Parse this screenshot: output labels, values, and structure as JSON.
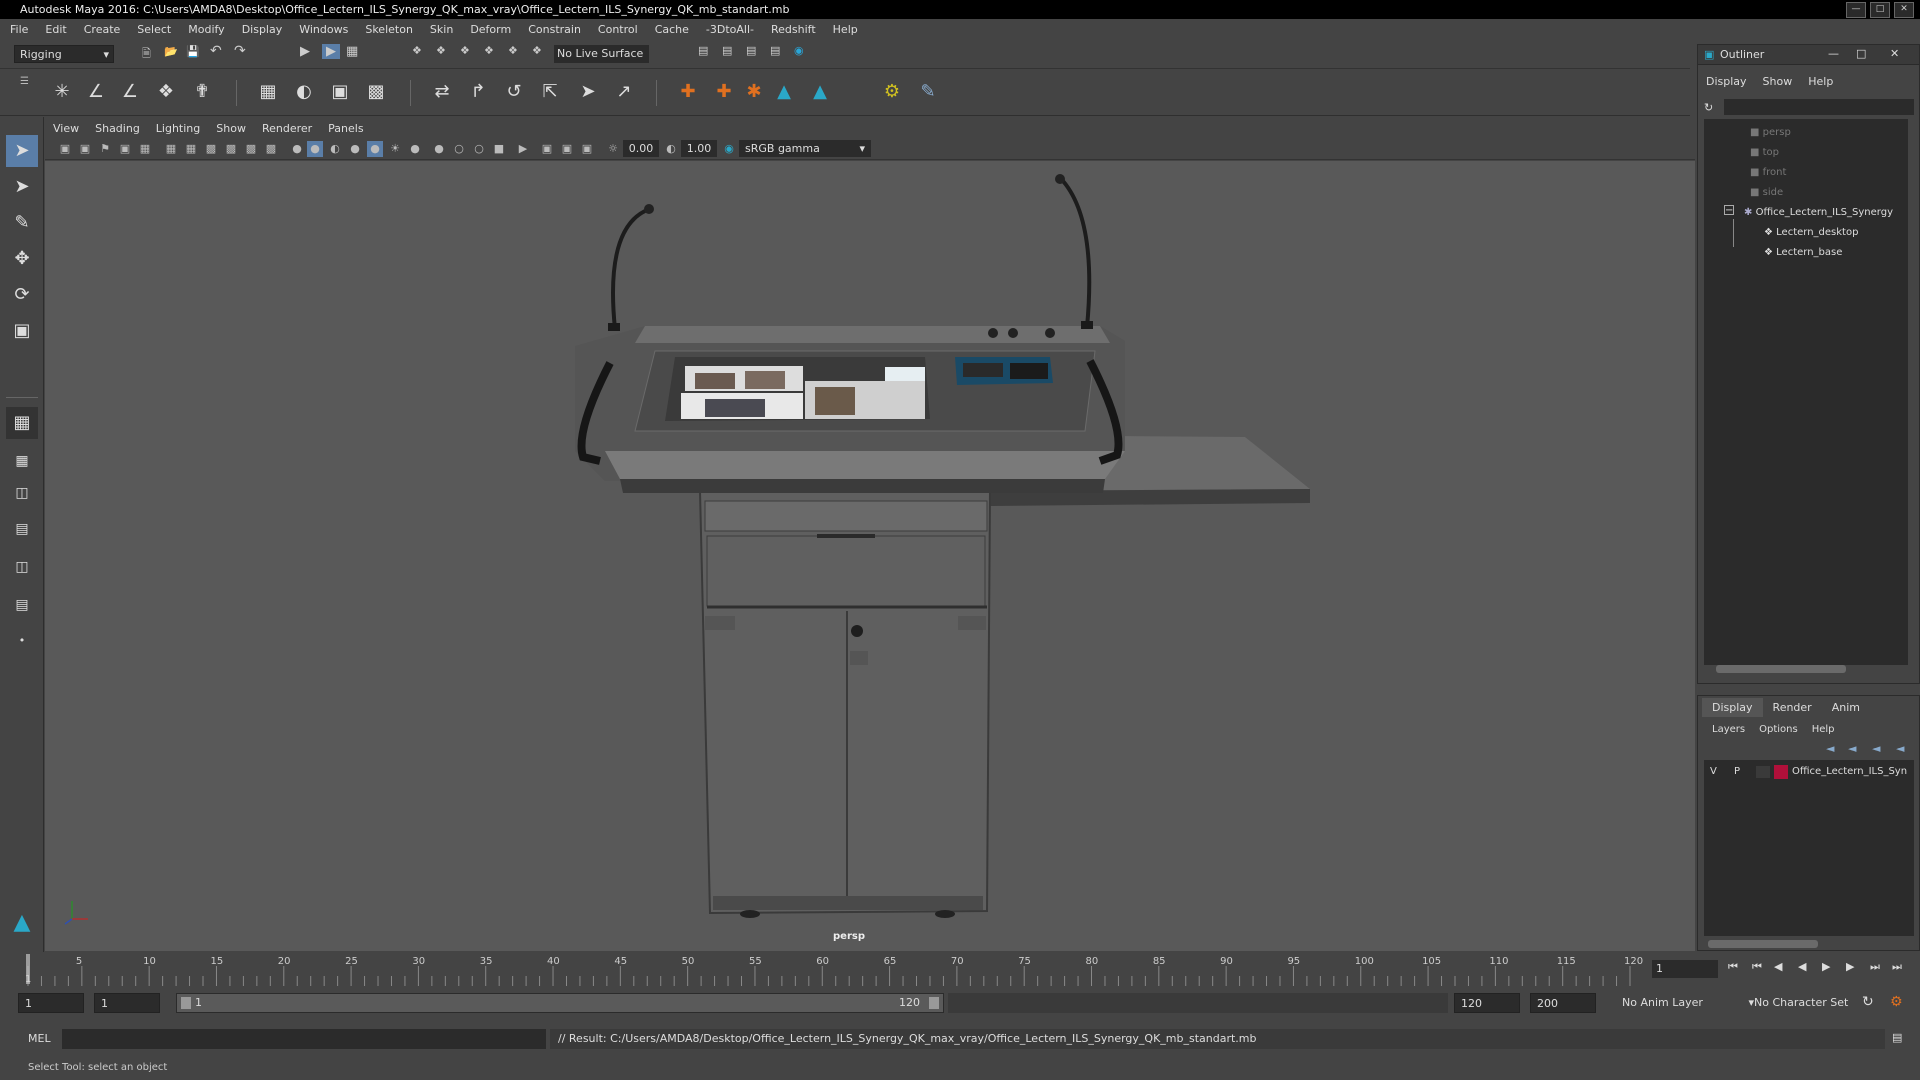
{
  "window": {
    "title": "Autodesk Maya 2016: C:\\Users\\AMDA8\\Desktop\\Office_Lectern_ILS_Synergy_QK_max_vray\\Office_Lectern_ILS_Synergy_QK_mb_standart.mb"
  },
  "menubar": [
    "File",
    "Edit",
    "Create",
    "Select",
    "Modify",
    "Display",
    "Windows",
    "Skeleton",
    "Skin",
    "Deform",
    "Constrain",
    "Control",
    "Cache",
    "-3DtoAll-",
    "Redshift",
    "Help"
  ],
  "toolbar": {
    "mode": "Rigging",
    "live_surface": "No Live Surface"
  },
  "panel": {
    "menus": [
      "View",
      "Shading",
      "Lighting",
      "Show",
      "Renderer",
      "Panels"
    ],
    "exposure": "0.00",
    "gamma": "1.00",
    "colorspace": "sRGB gamma",
    "camera_label": "persp"
  },
  "outliner": {
    "title": "Outliner",
    "menus": [
      "Display",
      "Show",
      "Help"
    ],
    "items": [
      "persp",
      "top",
      "front",
      "side",
      "Office_Lectern_ILS_Synergy",
      "Lectern_desktop",
      "Lectern_base"
    ]
  },
  "channel_box": {
    "tabs": [
      "Display",
      "Render",
      "Anim"
    ],
    "menus": [
      "Layers",
      "Options",
      "Help"
    ],
    "layer": {
      "v": "V",
      "p": "P",
      "name": "Office_Lectern_ILS_Syn",
      "color": "#b0103a"
    }
  },
  "timeline": {
    "ticks": [
      "1",
      "5",
      "10",
      "15",
      "20",
      "25",
      "30",
      "35",
      "40",
      "45",
      "50",
      "55",
      "60",
      "65",
      "70",
      "75",
      "80",
      "85",
      "90",
      "95",
      "100",
      "105",
      "110",
      "115",
      "120"
    ],
    "current_frame": "1"
  },
  "range": {
    "start": "1",
    "playback_start": "1",
    "slider_start": "1",
    "slider_end": "120",
    "playback_end": "120",
    "end": "200",
    "anim_layer": "No Anim Layer",
    "char_set": "No Character Set"
  },
  "cmd": {
    "lang": "MEL",
    "result": "// Result: C:/Users/AMDA8/Desktop/Office_Lectern_ILS_Synergy_QK_max_vray/Office_Lectern_ILS_Synergy_QK_mb_standart.mb"
  },
  "help_line": "Select Tool: select an object"
}
